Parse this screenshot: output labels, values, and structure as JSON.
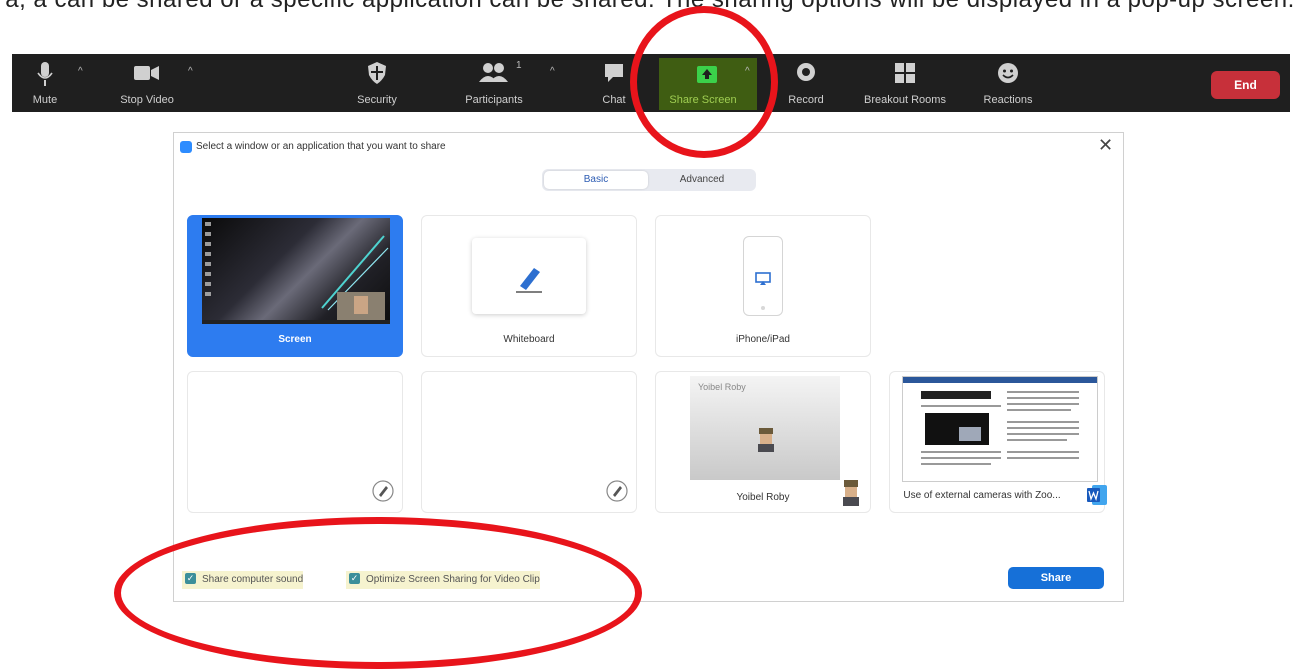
{
  "clipped_text": "a, a can be shared or a specific application can be shared. The sharing options will be displayed in a pop-up screen.",
  "toolbar": {
    "mute": "Mute",
    "stop_video": "Stop Video",
    "security": "Security",
    "participants": "Participants",
    "participants_count": "1",
    "chat": "Chat",
    "share_screen": "Share Screen",
    "record": "Record",
    "breakout_rooms": "Breakout Rooms",
    "reactions": "Reactions",
    "end": "End"
  },
  "dialog": {
    "title": "Select a window or an application that you want to share",
    "tabs": [
      "Basic",
      "Advanced"
    ],
    "tiles": [
      "Screen",
      "Whiteboard",
      "iPhone/iPad",
      "",
      "",
      "Yoibel Roby",
      "Use of external cameras with Zoo..."
    ],
    "yoibel_thumb_text": "Yoibel Roby",
    "share_sound": "Share computer sound",
    "optimize": "Optimize Screen Sharing for Video Clip",
    "share_button": "Share"
  },
  "colors": {
    "toolbar_bg": "#1f1f1f",
    "share_highlight": "#3f5d12",
    "end_red": "#c7303a",
    "accent_blue": "#2d7cf0",
    "annotation_red": "#e8141b"
  }
}
